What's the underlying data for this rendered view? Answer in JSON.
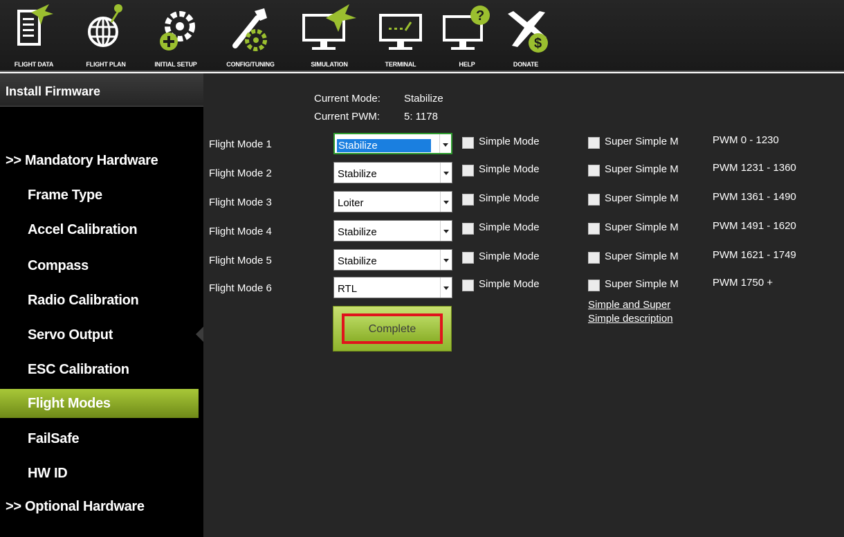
{
  "toolbar": {
    "items": [
      {
        "label": "FLIGHT DATA",
        "icon": "flight-data-icon"
      },
      {
        "label": "FLIGHT PLAN",
        "icon": "flight-plan-icon"
      },
      {
        "label": "INITIAL SETUP",
        "icon": "initial-setup-icon"
      },
      {
        "label": "CONFIG/TUNING",
        "icon": "config-tuning-icon"
      },
      {
        "label": "SIMULATION",
        "icon": "simulation-icon"
      },
      {
        "label": "TERMINAL",
        "icon": "terminal-icon"
      },
      {
        "label": "HELP",
        "icon": "help-icon"
      },
      {
        "label": "DONATE",
        "icon": "donate-icon"
      }
    ]
  },
  "sidebar": {
    "header": "Install Firmware",
    "items": [
      {
        "label": ">> Mandatory Hardware"
      },
      {
        "label": "Frame Type"
      },
      {
        "label": "Accel Calibration"
      },
      {
        "label": "Compass"
      },
      {
        "label": "Radio Calibration"
      },
      {
        "label": "Servo Output"
      },
      {
        "label": "ESC Calibration"
      },
      {
        "label": "Flight Modes"
      },
      {
        "label": "FailSafe"
      },
      {
        "label": "HW ID"
      },
      {
        "label": ">> Optional Hardware"
      }
    ],
    "active": "Flight Modes"
  },
  "main": {
    "current_mode_label": "Current Mode:",
    "current_mode_value": "Stabilize",
    "current_pwm_label": "Current PWM:",
    "current_pwm_value": "5: 1178",
    "modes": [
      {
        "label": "Flight Mode 1",
        "value": "Stabilize",
        "simple": "Simple Mode",
        "super_simple": "Super Simple M",
        "pwm": "PWM 0 - 1230"
      },
      {
        "label": "Flight Mode 2",
        "value": "Stabilize",
        "simple": "Simple Mode",
        "super_simple": "Super Simple M",
        "pwm": "PWM 1231 - 1360"
      },
      {
        "label": "Flight Mode 3",
        "value": "Loiter",
        "simple": "Simple Mode",
        "super_simple": "Super Simple M",
        "pwm": "PWM 1361 - 1490"
      },
      {
        "label": "Flight Mode 4",
        "value": "Stabilize",
        "simple": "Simple Mode",
        "super_simple": "Super Simple M",
        "pwm": "PWM 1491 - 1620"
      },
      {
        "label": "Flight Mode 5",
        "value": "Stabilize",
        "simple": "Simple Mode",
        "super_simple": "Super Simple M",
        "pwm": "PWM 1621 - 1749"
      },
      {
        "label": "Flight Mode 6",
        "value": "RTL",
        "simple": "Simple Mode",
        "super_simple": "Super Simple M",
        "pwm": "PWM 1750 +"
      }
    ],
    "complete_label": "Complete",
    "help_link_line1": "Simple and Super",
    "help_link_line2": "Simple description"
  },
  "colors": {
    "accent_green": "#8fb42c",
    "panel_bg": "#262626",
    "sidebar_bg": "#000000",
    "highlight_red": "#e0141c",
    "selection_blue": "#1a7fe0"
  }
}
